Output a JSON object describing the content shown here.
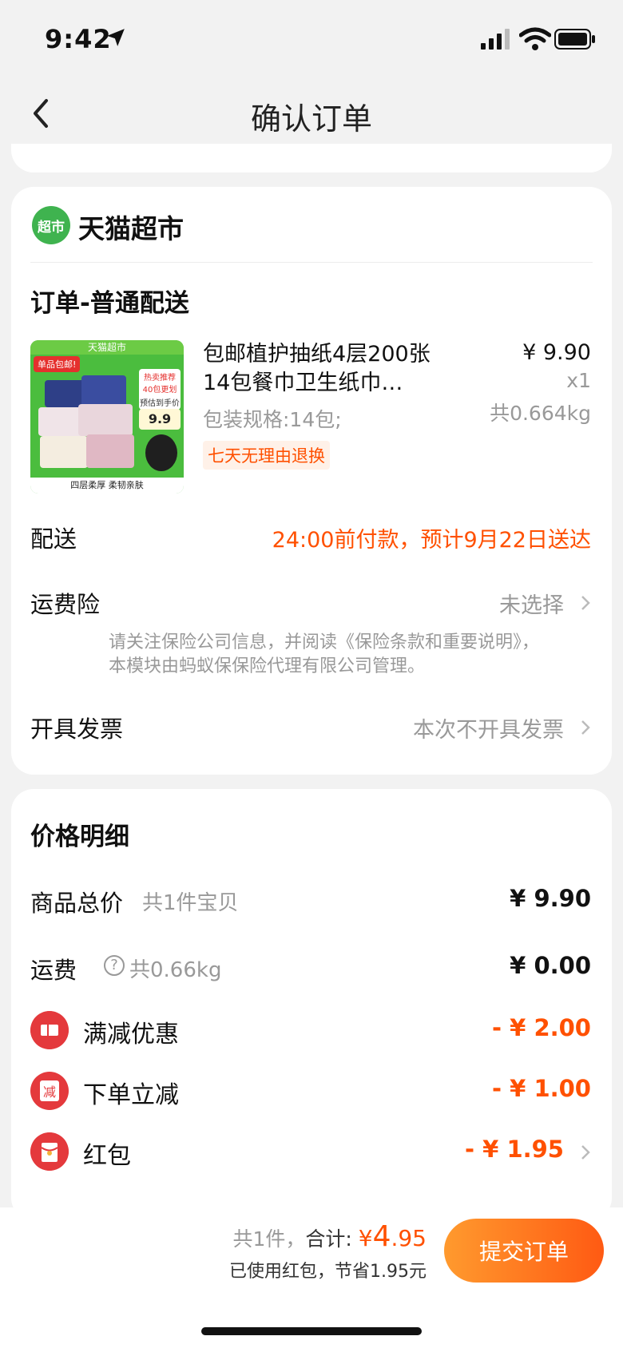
{
  "status": {
    "time": "9:42"
  },
  "nav": {
    "title": "确认订单"
  },
  "shop": {
    "logo_text": "超市",
    "name": "天猫超市"
  },
  "order": {
    "delivery_type": "订单-普通配送",
    "product": {
      "image": {
        "top_text": "天猫超市",
        "badge": "单品包邮!",
        "label1": "热卖推荐",
        "label2": "40包更划算",
        "price_label": "预估到手价",
        "price": "9.9",
        "bottom_text": "四层柔厚 柔韧亲肤"
      },
      "title": "包邮植护抽纸4层200张14包餐巾卫生纸巾…",
      "spec": "包装规格:14包;",
      "tag": "七天无理由退换",
      "price": "¥ 9.90",
      "qty": "x1",
      "weight": "共0.664kg"
    },
    "delivery": {
      "label": "配送",
      "value": "24:00前付款，预计9月22日送达"
    },
    "insurance": {
      "label": "运费险",
      "value": "未选择",
      "note": "请关注保险公司信息，并阅读《保险条款和重要说明》，本模块由蚂蚁保保险代理有限公司管理。"
    },
    "invoice": {
      "label": "开具发票",
      "value": "本次不开具发票"
    }
  },
  "price_detail": {
    "title": "价格明细",
    "goods": {
      "label": "商品总价",
      "sub": "共1件宝贝",
      "value": "¥ 9.90"
    },
    "shipping": {
      "label": "运费",
      "sub": "共0.66kg",
      "value": "¥ 0.00"
    },
    "discount1": {
      "label": "满减优惠",
      "value": "- ¥ 2.00"
    },
    "discount2": {
      "label": "下单立减",
      "icon_text": "减",
      "value": "- ¥ 1.00"
    },
    "redpacket": {
      "label": "红包",
      "value": "- ¥ 1.95"
    }
  },
  "bottom": {
    "count": "共1件，",
    "total_label": "合计:",
    "currency": "¥",
    "total_int": "4",
    "total_dec": ".95",
    "saved": "已使用红包，节省1.95元",
    "submit": "提交订单"
  },
  "colors": {
    "accent": "#ff5000",
    "brand_green": "#3fb34f",
    "discount_red": "#e4393c"
  }
}
